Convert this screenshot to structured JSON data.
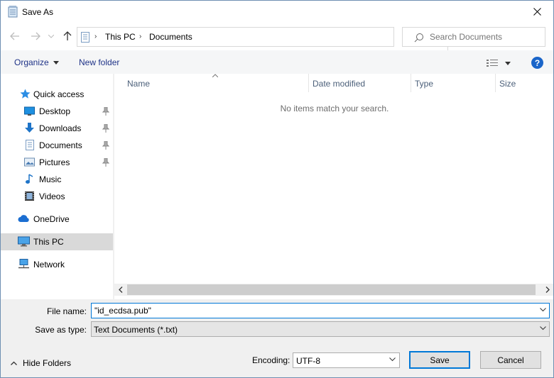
{
  "window": {
    "title": "Save As"
  },
  "address": {
    "crumbs": [
      "This PC",
      "Documents"
    ]
  },
  "search": {
    "placeholder": "Search Documents"
  },
  "toolbar": {
    "organize_label": "Organize",
    "new_folder_label": "New folder"
  },
  "nav": {
    "items": [
      {
        "label": "Quick access",
        "icon": "star-icon"
      },
      {
        "label": "Desktop",
        "icon": "desktop-icon",
        "pinned": true
      },
      {
        "label": "Downloads",
        "icon": "download-icon",
        "pinned": true
      },
      {
        "label": "Documents",
        "icon": "document-icon",
        "pinned": true
      },
      {
        "label": "Pictures",
        "icon": "pictures-icon",
        "pinned": true
      },
      {
        "label": "Music",
        "icon": "music-icon"
      },
      {
        "label": "Videos",
        "icon": "video-icon"
      },
      {
        "label": "OneDrive",
        "icon": "cloud-icon"
      },
      {
        "label": "This PC",
        "icon": "computer-icon",
        "selected": true
      },
      {
        "label": "Network",
        "icon": "network-icon"
      }
    ]
  },
  "file_list": {
    "columns": [
      "Name",
      "Date modified",
      "Type",
      "Size"
    ],
    "empty_message": "No items match your search."
  },
  "fields": {
    "file_name_label": "File name:",
    "file_name_value": "\"id_ecdsa.pub\"",
    "save_type_label": "Save as type:",
    "save_type_value": "Text Documents (*.txt)"
  },
  "footer": {
    "hide_folders_label": "Hide Folders",
    "encoding_label": "Encoding:",
    "encoding_value": "UTF-8",
    "save_label": "Save",
    "cancel_label": "Cancel"
  },
  "colors": {
    "accent": "#0078d7",
    "link_blue": "#1e3287",
    "selected_bg": "#d9d9d9",
    "help_blue": "#1a65c9"
  }
}
